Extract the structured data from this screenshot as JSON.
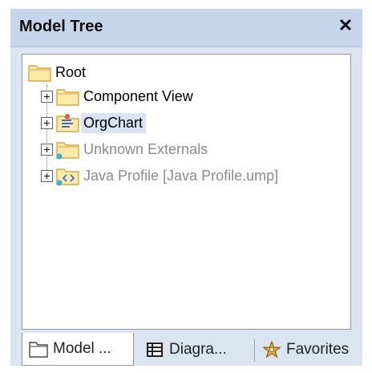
{
  "panel": {
    "title": "Model Tree",
    "close_glyph": "✕"
  },
  "tree": {
    "root": {
      "label": "Root",
      "icon": "folder-icon"
    },
    "children": [
      {
        "label": "Component View",
        "icon": "folder-icon",
        "state": "normal"
      },
      {
        "label": "OrgChart",
        "icon": "package-icon",
        "state": "selected"
      },
      {
        "label": "Unknown Externals",
        "icon": "external-folder-icon",
        "state": "disabled"
      },
      {
        "label": "Java Profile [Java Profile.ump]",
        "icon": "profile-folder-icon",
        "state": "disabled"
      }
    ]
  },
  "tabs": [
    {
      "label": "Model ...",
      "icon": "folder-icon",
      "active": true
    },
    {
      "label": "Diagra...",
      "icon": "diagram-icon",
      "active": false
    },
    {
      "label": "Favorites",
      "icon": "star-icon",
      "active": false
    }
  ],
  "colors": {
    "titlebar": "#c6d6ea",
    "panel_bg": "#dbe5f1",
    "folder_fill": "#fde9a8",
    "folder_stroke": "#d9a73e",
    "selected_bg": "#d9e3f6",
    "disabled_text": "#8b8b8b"
  }
}
